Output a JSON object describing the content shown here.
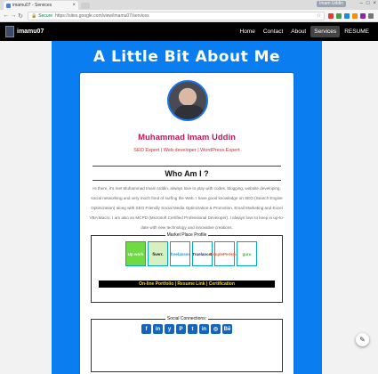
{
  "browser": {
    "tab_title": "imamu07 - Services",
    "user_badge": "Imam Uddin",
    "address_secure": "Secure",
    "address_url": "https://sites.google.com/view/imamu07/services"
  },
  "site": {
    "logo_text": "imamu07",
    "nav": [
      "Home",
      "Contact",
      "About",
      "Services",
      "RESUME"
    ]
  },
  "page": {
    "title": "A Little Bit About Me",
    "name": "Muhammad Imam Uddin",
    "roles": "SEO Expert | Web developer | WordPress Expert",
    "about_heading": "Who Am I ?",
    "bio": "Hi there, it's me! Muhammad Imam Uddin, always love to play with codes, blogging, website developing, social networking and very much fond of surfing the Web. I have good knowledge on SEO (Search Engine Optimization) along with SEO Friendly Social Media Optimization & Promotion, Email Marketing and Excel VBA Macro. I am also an MCPD (Microsoft Certified Professional Developer). I always love to keep in up-to-date with new technology and innovative creations.",
    "marketplace_title": "Market Place Profile",
    "marketplaces": [
      "Up work",
      "fiverr.",
      "freelancer",
      "Truelancer",
      "PeoplePerHour",
      "guru"
    ],
    "links_bar": "On-line Portfolio | Resume Link | Certification",
    "social_title": "Social Connections:",
    "social_icons": [
      "f",
      "in",
      "y",
      "P",
      "t",
      "in",
      "◎",
      "Bē"
    ]
  },
  "colors": {
    "header_bg": "#000000",
    "panel_blue": "#0a7ef0",
    "name_color": "#c2185b",
    "roles_color": "#d32f2f",
    "links_bar_text": "#ffd600"
  },
  "icons": {
    "tab_favicon": "google-sites-favicon",
    "edit_fab": "pencil-icon"
  }
}
